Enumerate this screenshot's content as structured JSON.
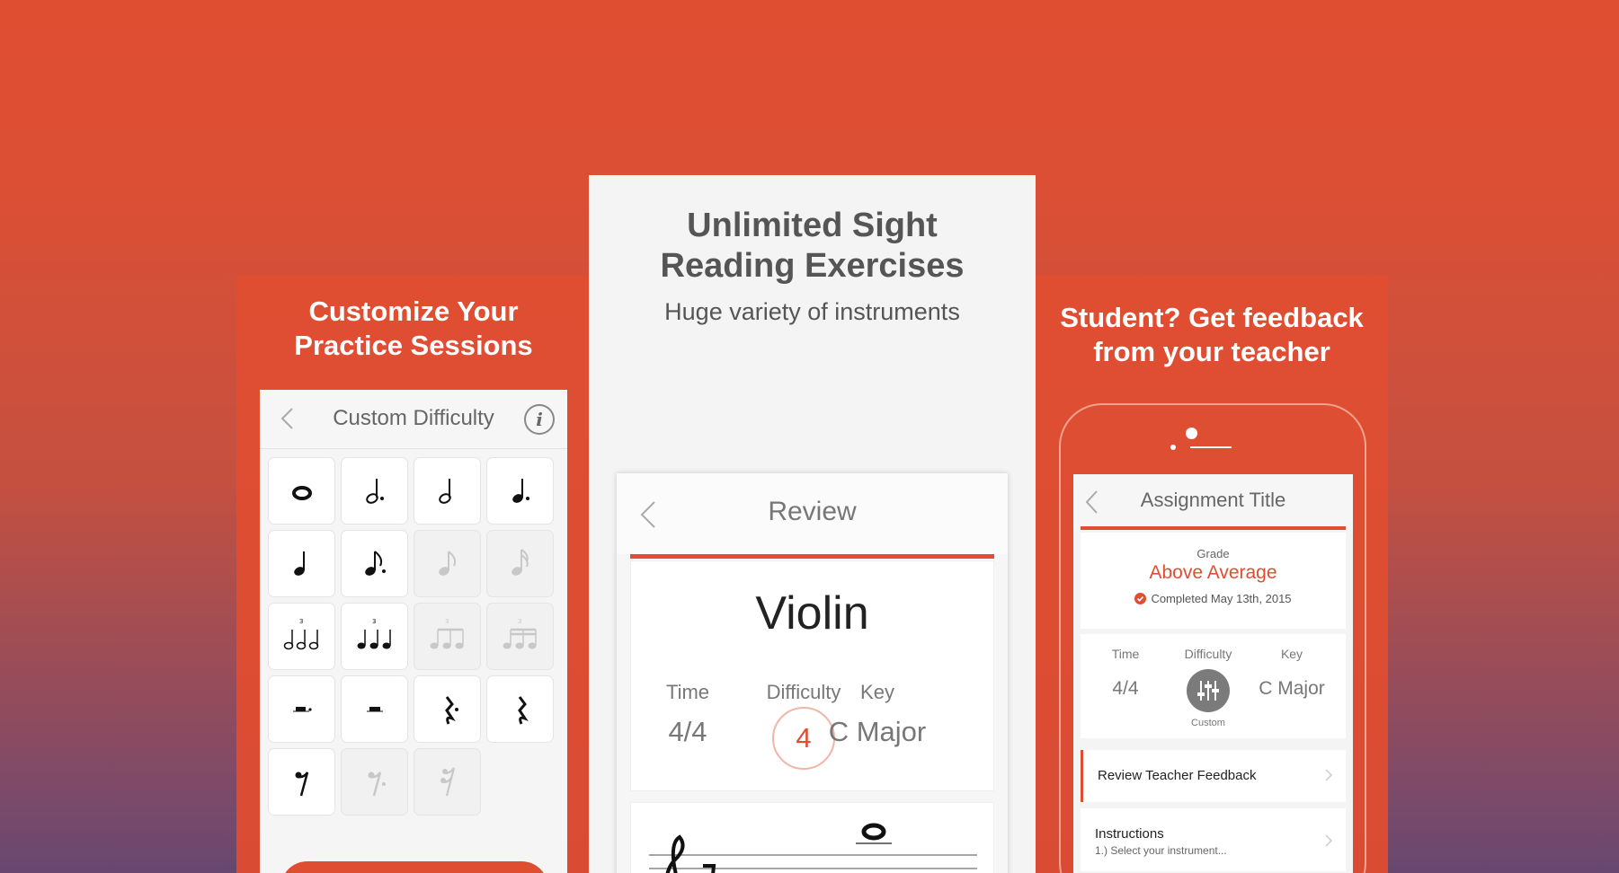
{
  "left": {
    "heading_line1": "Customize Your",
    "heading_line2": "Practice Sessions",
    "screen_title": "Custom Difficulty",
    "info_icon": "i",
    "tiles": [
      {
        "icon": "whole-note-icon",
        "enabled": true
      },
      {
        "icon": "dotted-half-note-icon",
        "enabled": true
      },
      {
        "icon": "half-note-icon",
        "enabled": true
      },
      {
        "icon": "dotted-quarter-note-icon",
        "enabled": true
      },
      {
        "icon": "quarter-note-icon",
        "enabled": true
      },
      {
        "icon": "dotted-eighth-note-icon",
        "enabled": true
      },
      {
        "icon": "eighth-note-icon",
        "enabled": false
      },
      {
        "icon": "sixteenth-note-icon",
        "enabled": false
      },
      {
        "icon": "half-triplet-icon",
        "enabled": true
      },
      {
        "icon": "quarter-triplet-icon",
        "enabled": true
      },
      {
        "icon": "eighth-triplet-icon",
        "enabled": false
      },
      {
        "icon": "sixteenth-triplet-icon",
        "enabled": false
      },
      {
        "icon": "dotted-half-rest-icon",
        "enabled": true
      },
      {
        "icon": "half-rest-icon",
        "enabled": true
      },
      {
        "icon": "dotted-quarter-rest-icon",
        "enabled": true
      },
      {
        "icon": "quarter-rest-icon",
        "enabled": true
      },
      {
        "icon": "eighth-rest-icon",
        "enabled": true
      },
      {
        "icon": "dotted-eighth-rest-icon",
        "enabled": false
      },
      {
        "icon": "sixteenth-rest-icon",
        "enabled": false
      }
    ]
  },
  "center": {
    "title_line1": "Unlimited Sight",
    "title_line2": "Reading Exercises",
    "subtitle": "Huge variety of instruments",
    "screen_title": "Review",
    "instrument": "Violin",
    "time_label": "Time",
    "time_value": "4/4",
    "difficulty_label": "Difficulty",
    "difficulty_value": "4",
    "key_label": "Key",
    "key_value": "C Major"
  },
  "right": {
    "heading_line1": "Student? Get feedback",
    "heading_line2": "from your teacher",
    "screen_title": "Assignment Title",
    "grade_label": "Grade",
    "grade_value": "Above Average",
    "completed": "Completed May 13th, 2015",
    "time_label": "Time",
    "time_value": "4/4",
    "difficulty_label": "Difficulty",
    "difficulty_value": "Custom",
    "key_label": "Key",
    "key_value": "C Major",
    "row1": "Review Teacher Feedback",
    "row2": "Instructions",
    "row2_sub": "1.) Select your instrument..."
  },
  "colors": {
    "accent": "#e04e32",
    "background_top": "#e04e32",
    "background_bottom": "#67476f"
  }
}
